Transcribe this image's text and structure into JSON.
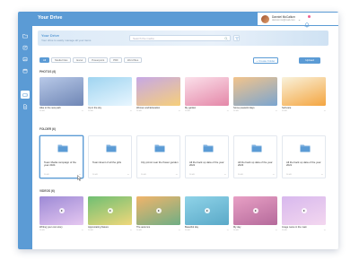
{
  "app": {
    "title": "Your Drive"
  },
  "user": {
    "name": "Danniel McCallum",
    "email": "danniel.mc@mail.com"
  },
  "banner": {
    "title": "Your Drive",
    "subtitle": "Your drive to easily manage all your items",
    "search_placeholder": "Search the media"
  },
  "filters": [
    "All",
    "Media Files",
    "Excel",
    "Powerpoint",
    "PDF",
    "Word files"
  ],
  "actions": {
    "create_folder": "+ Create Folder",
    "upload": "Upload"
  },
  "photos": {
    "label": "PHOTOS (6)",
    "items": [
      {
        "title": "Hike to the new path",
        "size": "16 kB",
        "colors": [
          "#b8c9e8",
          "#6f86b5"
        ]
      },
      {
        "title": "Up in the sky",
        "size": "16 kB",
        "colors": [
          "#9fd4f0",
          "#e8f6ff"
        ]
      },
      {
        "title": "Women and Education",
        "size": "16 kB",
        "colors": [
          "#c6a8e6",
          "#f6cf7a"
        ]
      },
      {
        "title": "My garden",
        "size": "16 kB",
        "colors": [
          "#fbe0ea",
          "#e487a8"
        ]
      },
      {
        "title": "Some peaceful days",
        "size": "16 kB",
        "colors": [
          "#f3c48b",
          "#7aa5d0"
        ]
      },
      {
        "title": "Self-care",
        "size": "16 kB",
        "colors": [
          "#f9f2dc",
          "#f4a540"
        ]
      }
    ]
  },
  "folders": {
    "label": "FOLDER (6)",
    "items": [
      {
        "title": "Team Media campaign of the year 2024",
        "size": "16 kB"
      },
      {
        "title": "Team Event of all the girls",
        "size": "16 kB"
      },
      {
        "title": "City picnic near the flower garden",
        "size": "16 kB"
      },
      {
        "title": "All the back up data of the year 2022",
        "size": "16 kB"
      },
      {
        "title": "All the back up data of the year 2023",
        "size": "16 kB"
      },
      {
        "title": "All the back up data of the year 2021",
        "size": "16 kB"
      }
    ]
  },
  "videos": {
    "label": "VIDEOS (6)",
    "items": [
      {
        "title": "Writing your own story",
        "size": "16 kB",
        "colors": [
          "#9d8ad6",
          "#e5c7f0"
        ]
      },
      {
        "title": "Appreciating Nature",
        "size": "16 kB",
        "colors": [
          "#6fbf73",
          "#f0d77a"
        ]
      },
      {
        "title": "The autumns",
        "size": "16 kB",
        "colors": [
          "#f1b46b",
          "#6fae84"
        ]
      },
      {
        "title": "Beautiful day",
        "size": "16 kB",
        "colors": [
          "#8fd3e8",
          "#5aa9c8"
        ]
      },
      {
        "title": "My day",
        "size": "16 kB",
        "colors": [
          "#e8a0c5",
          "#b56a9b"
        ]
      },
      {
        "title": "Image name in the main",
        "size": "16 kB",
        "colors": [
          "#d8b8ee",
          "#f3d7ef"
        ]
      }
    ]
  },
  "icons": {
    "sidebar": [
      "folder-icon",
      "share-icon",
      "image-icon",
      "calendar-icon",
      "drive-icon",
      "document-icon"
    ],
    "accent": "#5b9bd5"
  }
}
